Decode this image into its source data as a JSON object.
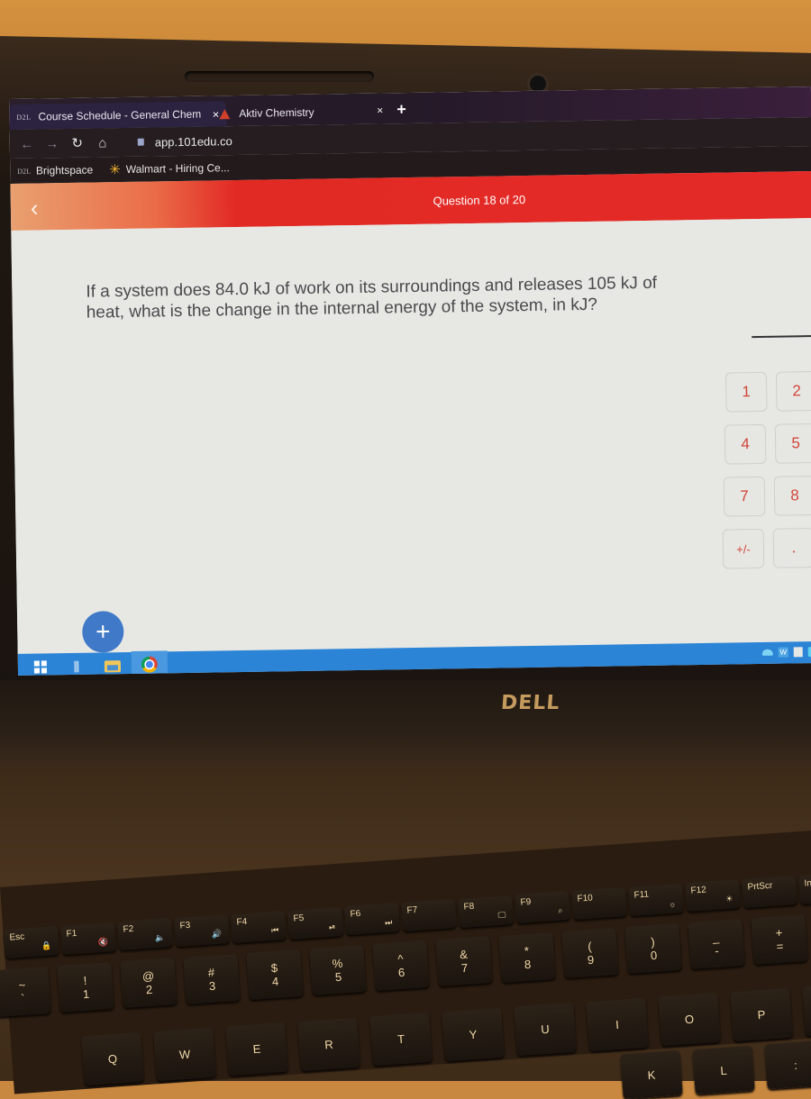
{
  "browser": {
    "tabs": [
      {
        "favicon": "D2L",
        "title": "Course Schedule - General Chem",
        "active": true,
        "close": "×"
      },
      {
        "favicon": "aktiv-icon",
        "title": "Aktiv Chemistry",
        "active": false,
        "close": "×"
      }
    ],
    "new_tab": "+",
    "nav": {
      "back": "←",
      "forward": "→",
      "reload": "↻",
      "home": "⌂"
    },
    "url": "app.101edu.co",
    "bookmarks": [
      {
        "favicon": "D2L",
        "label": "Brightspace"
      },
      {
        "favicon": "walmart-icon",
        "label": "Walmart - Hiring Ce..."
      }
    ]
  },
  "app": {
    "back_icon": "‹",
    "question_counter": "Question 18 of 20",
    "question_text": "If a system does 84.0 kJ of work on its surroundings and releases 105 kJ of heat, what is the change in the internal energy of the system, in kJ?",
    "answer_value": "",
    "keypad": [
      "1",
      "2",
      "4",
      "5",
      "7",
      "8",
      "+/-",
      "."
    ],
    "fab_label": "+",
    "colors": {
      "header": "#e42a26",
      "key_text": "#d2443a",
      "fab": "#3f79c8",
      "taskbar": "#2c84d6"
    }
  },
  "taskbar": {
    "items": [
      "start-icon",
      "task-view-icon",
      "file-explorer-icon",
      "chrome-icon"
    ],
    "tray": [
      "onedrive-icon",
      "word-icon",
      "flashcards-icon",
      "bluetooth-icon"
    ]
  },
  "laptop": {
    "brand": "DELL",
    "keyboard": {
      "fn_row": [
        {
          "label": "Esc",
          "sub": "🔒"
        },
        {
          "label": "F1",
          "sub": "🔇"
        },
        {
          "label": "F2",
          "sub": "🔈"
        },
        {
          "label": "F3",
          "sub": "🔊"
        },
        {
          "label": "F4",
          "sub": "⏮"
        },
        {
          "label": "F5",
          "sub": "⏯"
        },
        {
          "label": "F6",
          "sub": "⏭"
        },
        {
          "label": "F7",
          "sub": ""
        },
        {
          "label": "F8",
          "sub": "🖵"
        },
        {
          "label": "F9",
          "sub": "⌕"
        },
        {
          "label": "F10",
          "sub": ""
        },
        {
          "label": "F11",
          "sub": "☼"
        },
        {
          "label": "F12",
          "sub": "☀"
        },
        {
          "label": "PrtScr",
          "sub": ""
        },
        {
          "label": "Inse",
          "sub": ""
        }
      ],
      "num_row": [
        {
          "top": "~",
          "bot": "`"
        },
        {
          "top": "!",
          "bot": "1"
        },
        {
          "top": "@",
          "bot": "2"
        },
        {
          "top": "#",
          "bot": "3"
        },
        {
          "top": "$",
          "bot": "4"
        },
        {
          "top": "%",
          "bot": "5"
        },
        {
          "top": "^",
          "bot": "6"
        },
        {
          "top": "&",
          "bot": "7"
        },
        {
          "top": "*",
          "bot": "8"
        },
        {
          "top": "(",
          "bot": "9"
        },
        {
          "top": ")",
          "bot": "0"
        },
        {
          "top": "_",
          "bot": "-"
        },
        {
          "top": "+",
          "bot": "="
        }
      ],
      "qwerty_row": [
        "Q",
        "W",
        "E",
        "R",
        "T",
        "Y",
        "U",
        "I",
        "O",
        "P",
        "{"
      ],
      "home_row": [
        "K",
        "L",
        ":"
      ]
    }
  }
}
